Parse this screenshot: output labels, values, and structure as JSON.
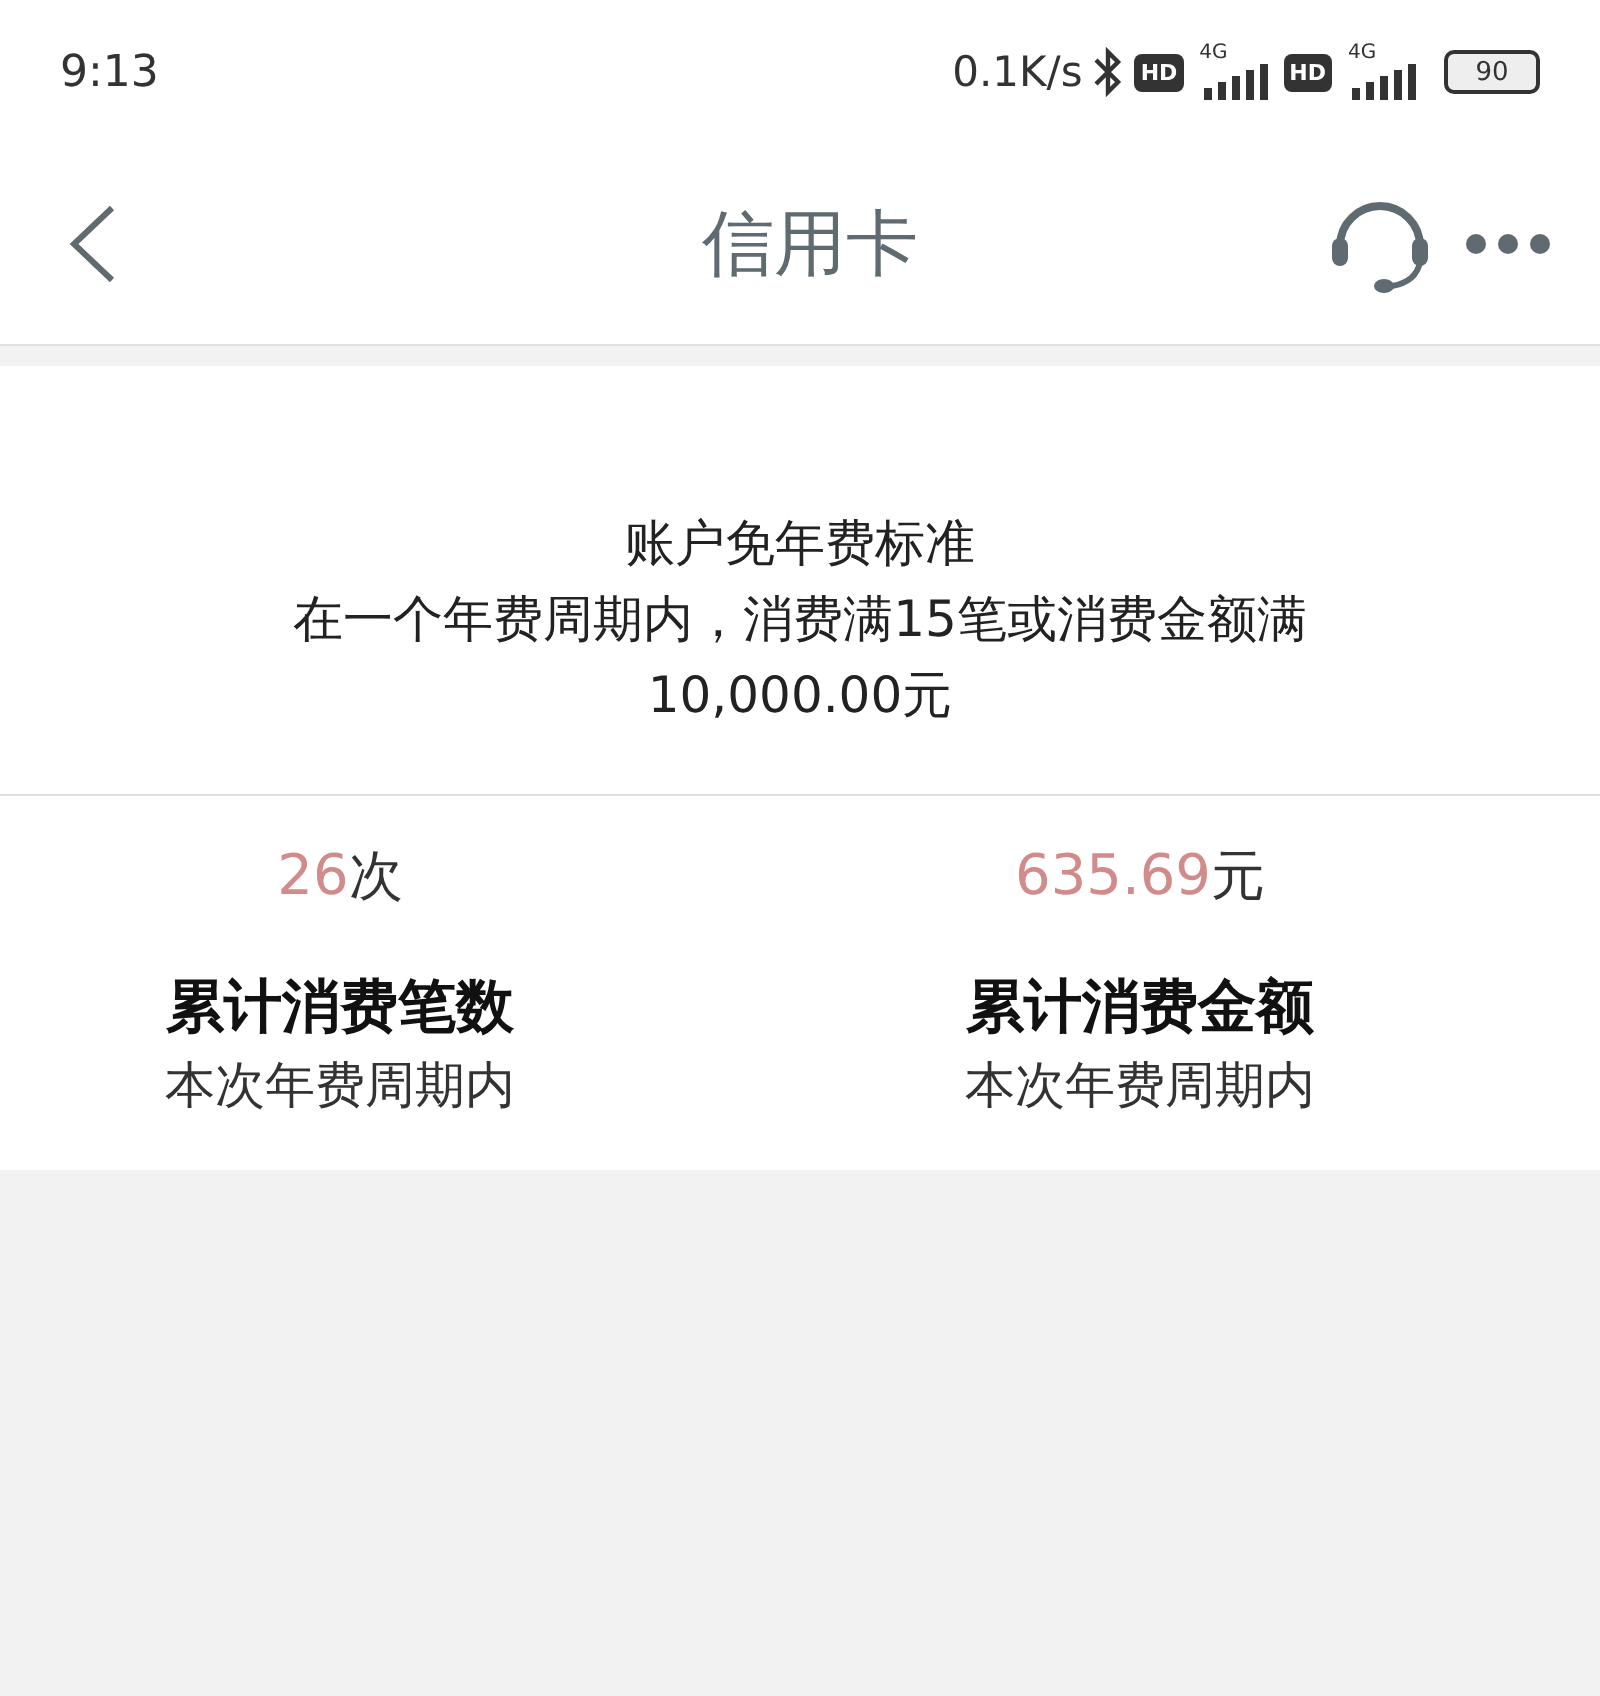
{
  "status_bar": {
    "time": "9:13",
    "speed": "0.1K/s",
    "sims": [
      {
        "hd": "HD",
        "network": "4G"
      },
      {
        "hd": "HD",
        "network": "4G"
      }
    ],
    "battery": "90"
  },
  "header": {
    "title": "信用卡"
  },
  "standard": {
    "title": "账户免年费标准",
    "description": "在一个年费周期内，消费满15笔或消费金额满10,000.00元"
  },
  "stats": [
    {
      "value": "26",
      "unit": "次",
      "label": "累计消费笔数",
      "sublabel": "本次年费周期内"
    },
    {
      "value": "635.69",
      "unit": "元",
      "label": "累计消费金额",
      "sublabel": "本次年费周期内"
    }
  ]
}
